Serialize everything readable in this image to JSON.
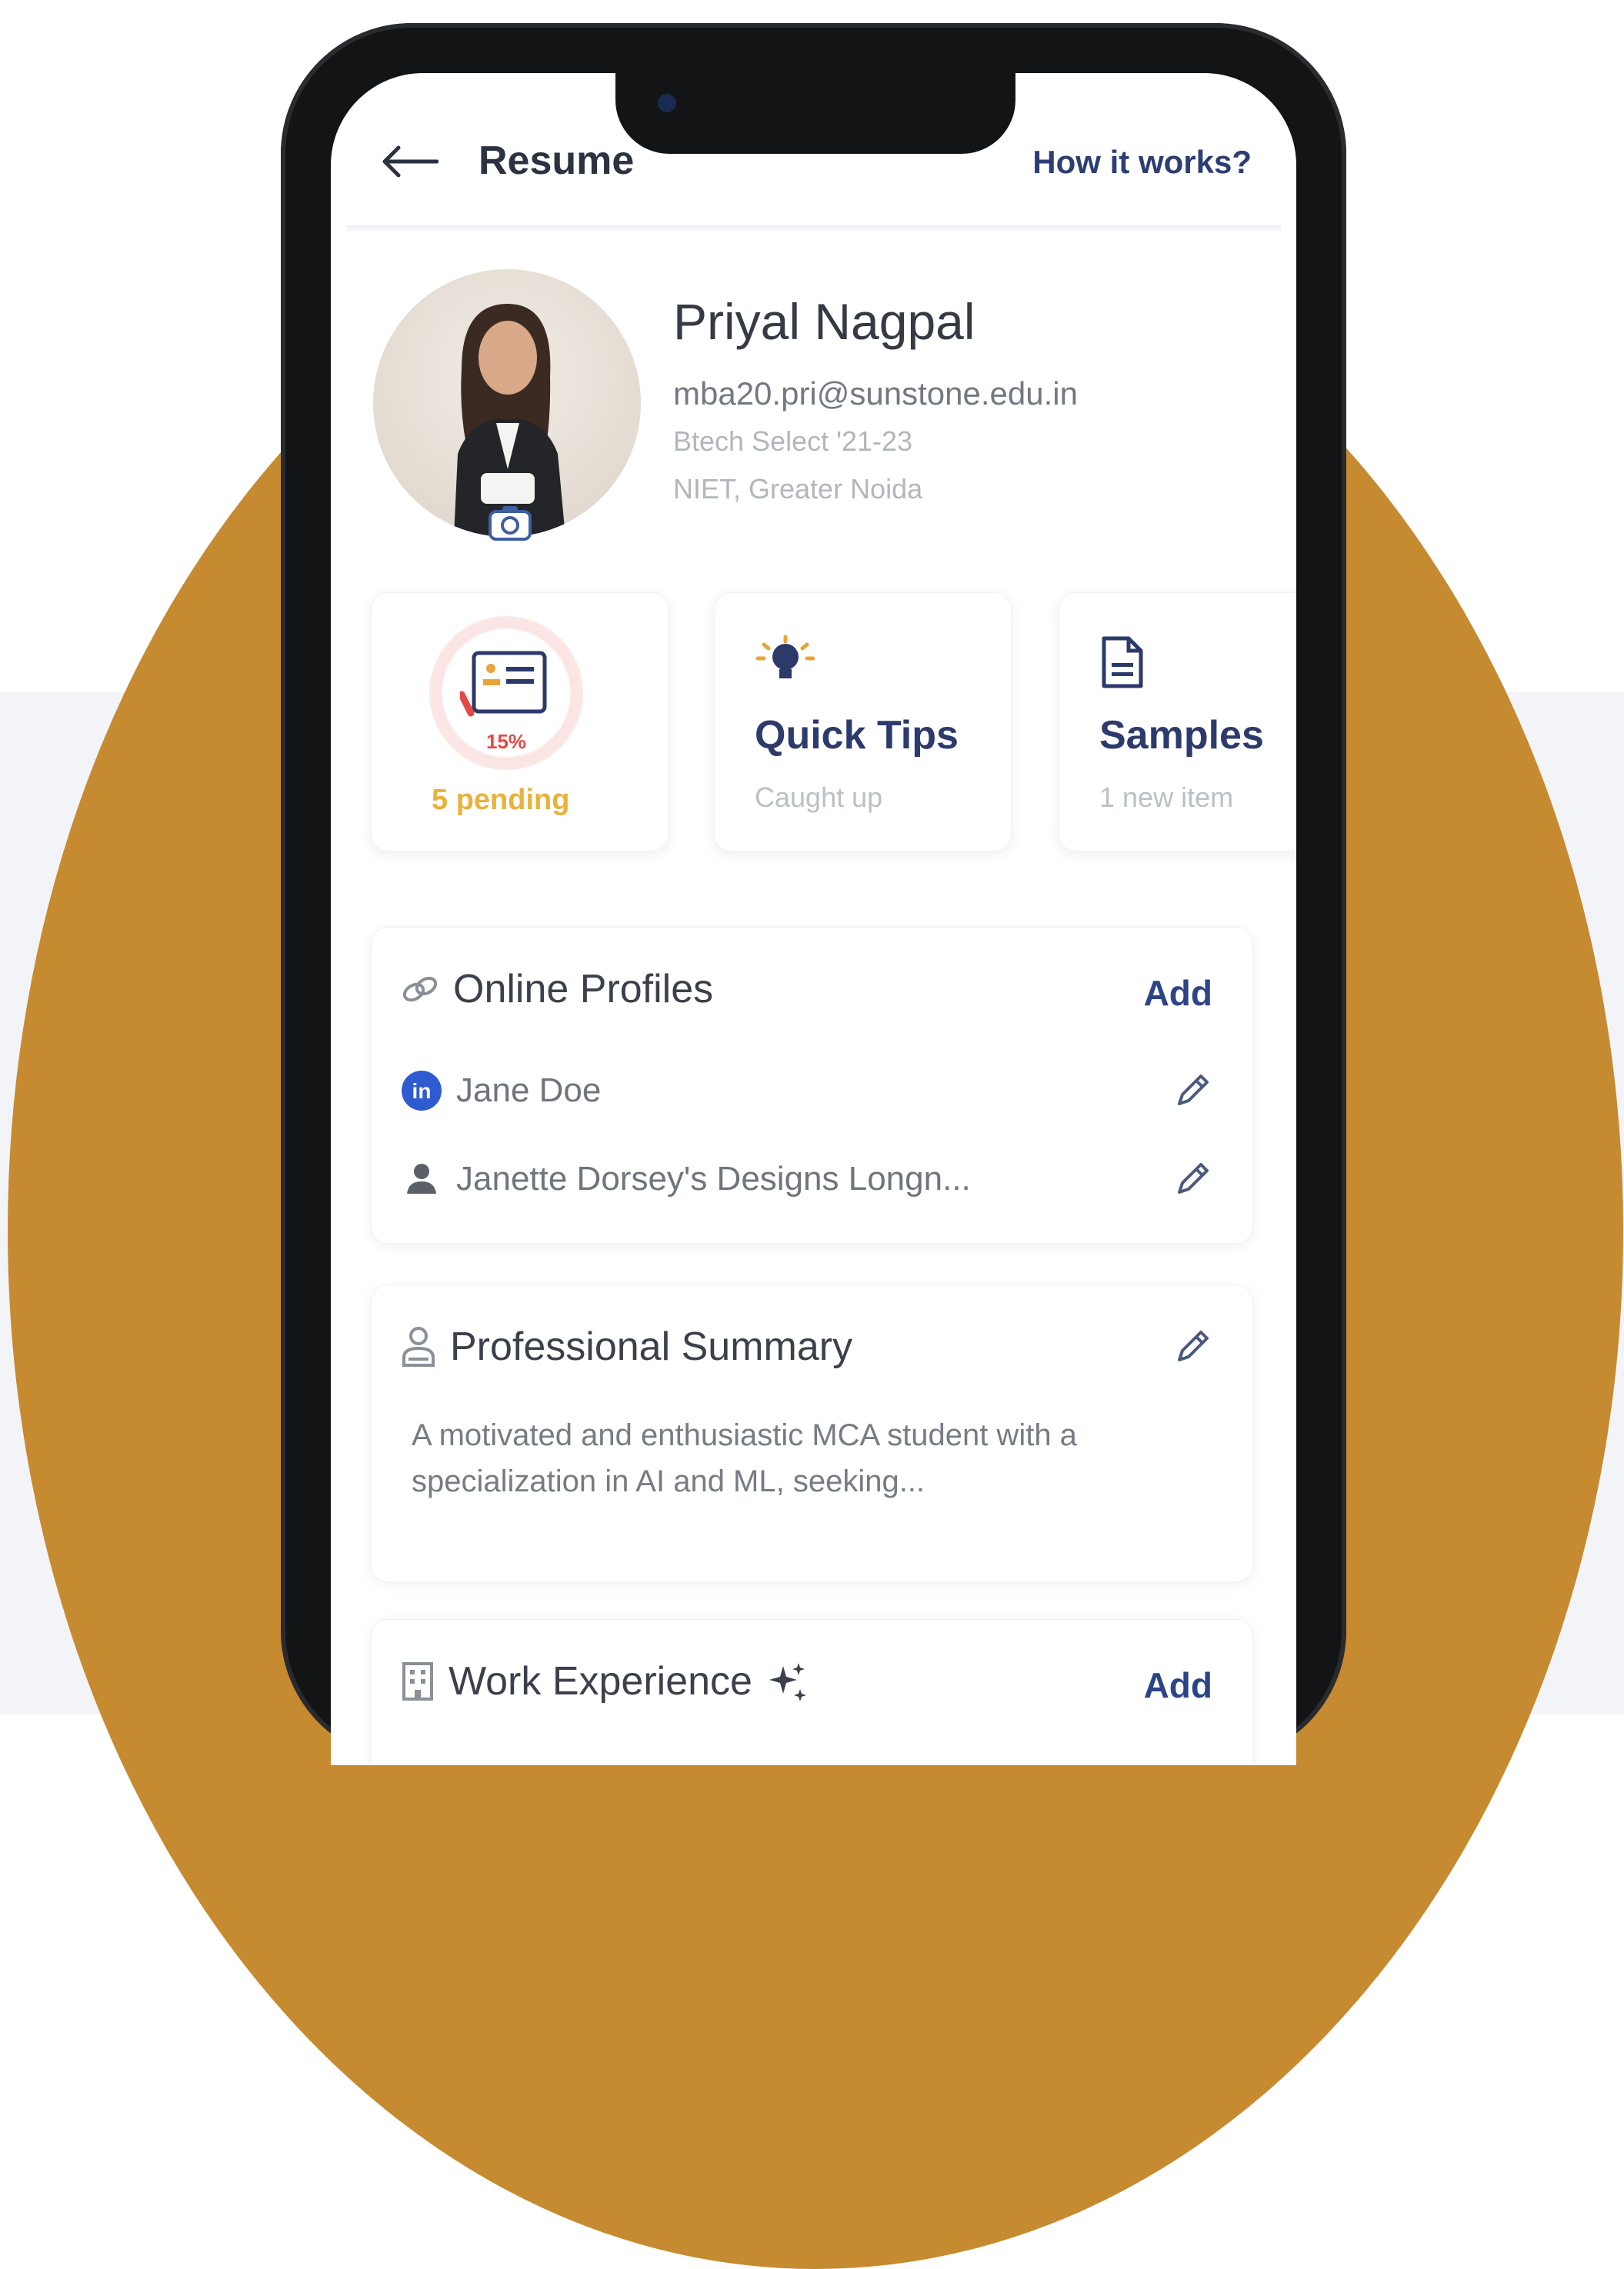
{
  "header": {
    "title": "Resume",
    "help_link": "How it works?"
  },
  "profile": {
    "name": "Priyal Nagpal",
    "email": "mba20.pri@sunstone.edu.in",
    "batch": "Btech Select '21-23",
    "college": "NIET, Greater Noida"
  },
  "cards": [
    {
      "title": "",
      "subtitle": "5 pending",
      "progress_label": "15%",
      "progress": 0.15,
      "icon": "resume-progress-icon"
    },
    {
      "title": "Quick Tips",
      "subtitle": "Caught up",
      "icon": "lightbulb-icon"
    },
    {
      "title": "Samples",
      "subtitle": "1 new item",
      "icon": "document-icon"
    }
  ],
  "online_profiles": {
    "title": "Online Profiles",
    "add_label": "Add",
    "items": [
      {
        "label": "Jane Doe",
        "icon": "linkedin-icon"
      },
      {
        "label": "Janette Dorsey's Designs Longn...",
        "icon": "person-icon"
      }
    ]
  },
  "professional_summary": {
    "title": "Professional Summary",
    "text": "A motivated and enthusiastic MCA student with a specialization in AI and ML, seeking..."
  },
  "work_experience": {
    "title": "Work Experience",
    "add_label": "Add"
  },
  "colors": {
    "accent": "#2c4487",
    "pending": "#e8b23c",
    "background_circle": "#c68a30"
  }
}
